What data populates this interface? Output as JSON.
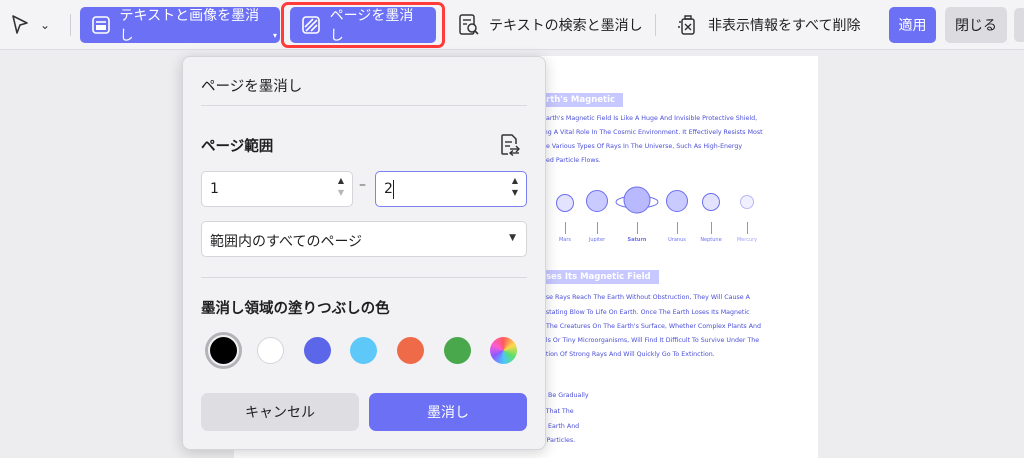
{
  "toolbar": {
    "redact_text_image": "テキストと画像を墨消し",
    "redact_page": "ページを墨消し",
    "search_redact": "テキストの検索と墨消し",
    "remove_hidden": "非表示情報をすべて削除",
    "apply": "適用",
    "close": "閉じる",
    "icons": [
      "cursor-icon",
      "chevron-down-icon",
      "redact-text-icon",
      "redact-page-icon",
      "search-document-icon",
      "remove-hidden-icon"
    ]
  },
  "dialog": {
    "title": "ページを墨消し",
    "page_range_label": "ページ範囲",
    "range_from": "1",
    "range_to": "2",
    "range_dash": "–",
    "range_option": "範囲内のすべてのページ",
    "fill_color_label": "墨消し領域の塗りつぶしの色",
    "colors": [
      "#000000",
      "#ffffff",
      "#5b66e8",
      "#5ec8f9",
      "#ef6a48",
      "#4aa84c",
      "rainbow"
    ],
    "selected_color": "#000000",
    "cancel": "キャンセル",
    "confirm": "墨消し"
  },
  "document": {
    "heading1": "rth's Magnetic",
    "para1": [
      "Earth's Magnetic Field Is Like A Huge And Invisible Protective Shield,",
      "ing A Vital Role In The Cosmic Environment. It Effectively Resists Most",
      "he Various Types Of Rays In The Universe, Such As High-Energy",
      "ged Particle Flows."
    ],
    "planets": [
      "Mars",
      "Jupiter",
      "Saturn",
      "Uranus",
      "Neptune",
      "Mercury"
    ],
    "heading2": "ses Its Magnetic Field",
    "para2": [
      "ese Rays Reach The Earth Without Obstruction, They Will Cause A",
      "astating Blow To Life On Earth. Once The Earth Loses Its Magnetic",
      ", The Creatures On The Earth's Surface, Whether Complex Plants And",
      "als Or Tiny Microorganisms, Will Find It Difficult To Survive Under The",
      "ation Of Strong Rays And Will Quickly Go To Extinction."
    ],
    "para3": [
      "d Be Gradually",
      "l That The",
      "n Earth And",
      "r Particles."
    ]
  }
}
